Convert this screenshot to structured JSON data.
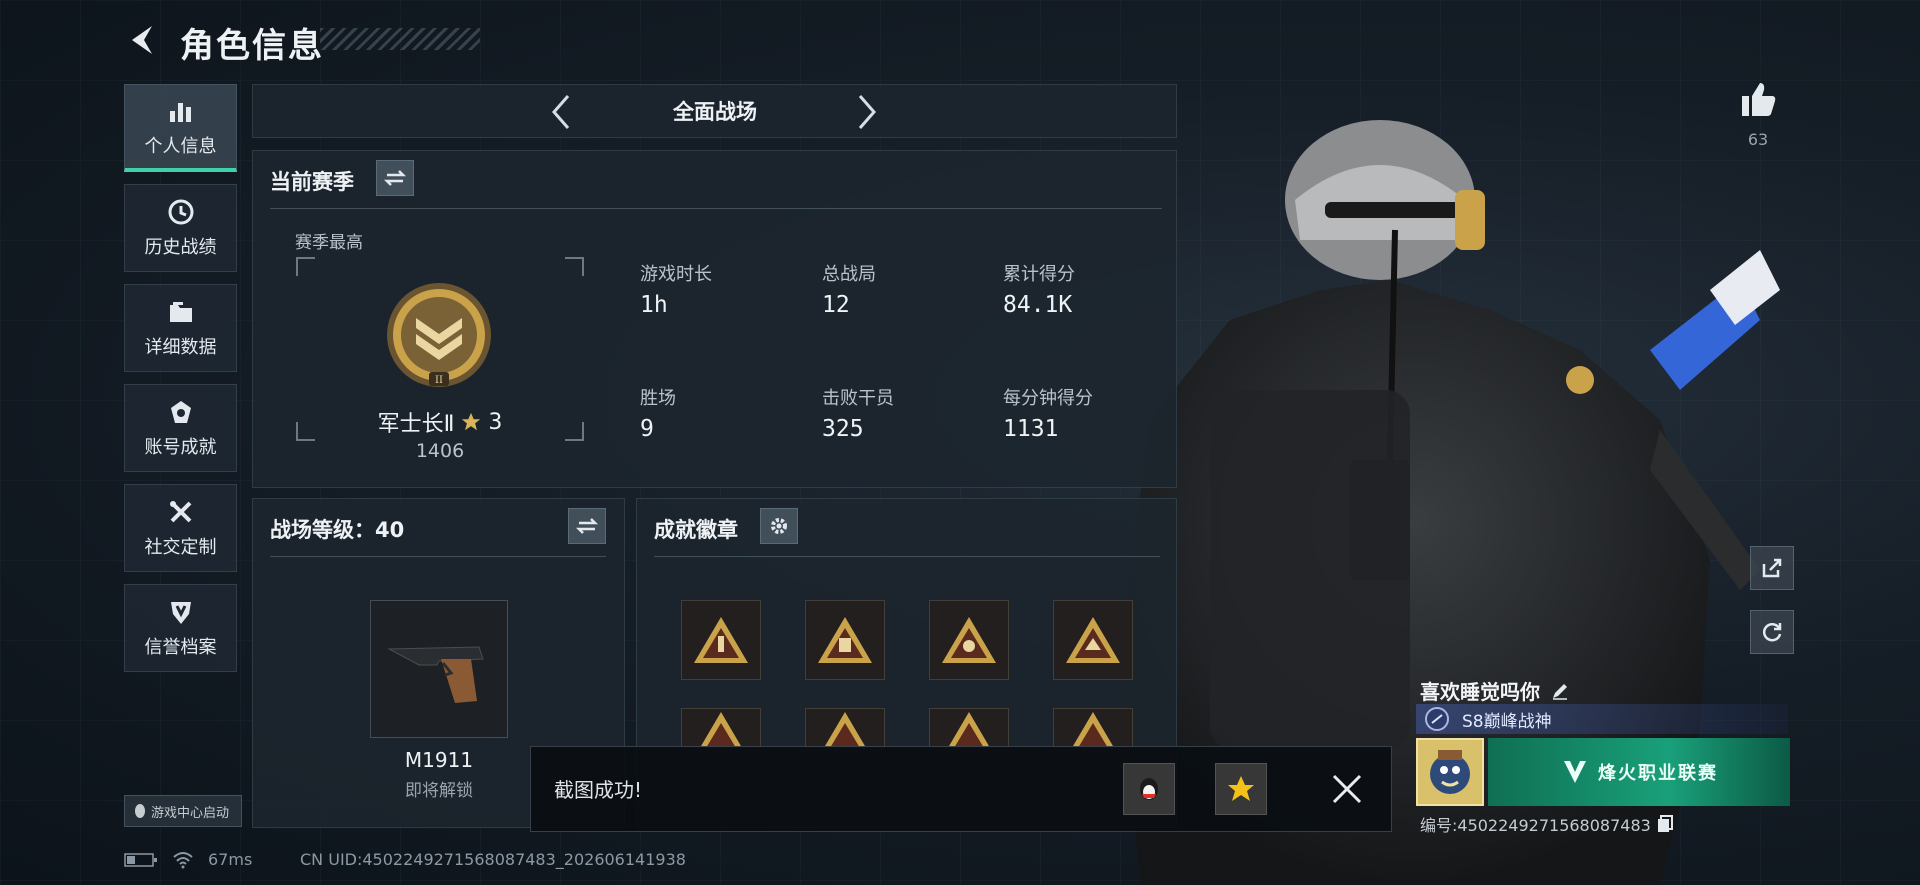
{
  "header": {
    "title": "角色信息"
  },
  "sidebar": {
    "items": [
      {
        "label": "个人信息",
        "icon": "bar-chart-icon"
      },
      {
        "label": "历史战绩",
        "icon": "clock-icon"
      },
      {
        "label": "详细数据",
        "icon": "folder-icon"
      },
      {
        "label": "账号成就",
        "icon": "medal-icon"
      },
      {
        "label": "社交定制",
        "icon": "tools-icon"
      },
      {
        "label": "信誉档案",
        "icon": "shield-icon"
      }
    ],
    "launch_label": "游戏中心启动"
  },
  "mode_selector": {
    "current": "全面战场"
  },
  "season": {
    "title": "当前赛季",
    "best_label": "赛季最高",
    "rank_name": "军士长Ⅱ",
    "rank_stars": "3",
    "rank_score": "1406",
    "stats": [
      {
        "label": "游戏时长",
        "value": "1h"
      },
      {
        "label": "总战局",
        "value": "12"
      },
      {
        "label": "累计得分",
        "value": "84.1K"
      },
      {
        "label": "胜场",
        "value": "9"
      },
      {
        "label": "击败干员",
        "value": "325"
      },
      {
        "label": "每分钟得分",
        "value": "1131"
      }
    ]
  },
  "battle_level": {
    "title": "战场等级：40",
    "weapon_name": "M1911",
    "weapon_status": "即将解锁"
  },
  "achievements": {
    "title": "成就徽章"
  },
  "toast": {
    "message": "截图成功!"
  },
  "likes": {
    "count": "63"
  },
  "player": {
    "name": "喜欢睡觉吗你",
    "title": "S8巅峰战神",
    "banner_text": "烽火职业联赛",
    "id_text": "编号:4502249271568087483"
  },
  "footer": {
    "ping": "67ms",
    "uid": "CN UID:4502249271568087483_202606141938"
  },
  "colors": {
    "accent": "#3fd2a8",
    "gold": "#c9a24a",
    "toast_bg": "#0a0e12"
  }
}
